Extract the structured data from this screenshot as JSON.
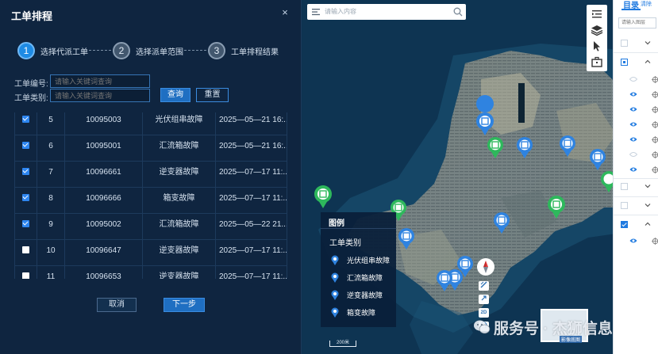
{
  "dialog": {
    "title": "工单排程",
    "close_symbol": "×",
    "steps": [
      {
        "num": "1",
        "label": "选择代派工单",
        "active": true
      },
      {
        "num": "2",
        "label": "选择派单范围",
        "active": false
      },
      {
        "num": "3",
        "label": "工单排程结果",
        "active": false
      }
    ],
    "filters": {
      "order_no_label": "工单编号:",
      "order_no_placeholder": "请输入关键词查询",
      "order_type_label": "工单类别:",
      "order_type_placeholder": "请输入关键词查询",
      "query_label": "查询",
      "reset_label": "重置"
    },
    "rows": [
      {
        "checked": true,
        "idx": "5",
        "no": "10095003",
        "type": "光伏组串故障",
        "time": "2025—05—21 16:..."
      },
      {
        "checked": true,
        "idx": "6",
        "no": "10095001",
        "type": "汇流箱故障",
        "time": "2025—05—21 16:..."
      },
      {
        "checked": true,
        "idx": "7",
        "no": "10096661",
        "type": "逆变器故障",
        "time": "2025—07—17 11:..."
      },
      {
        "checked": true,
        "idx": "8",
        "no": "10096666",
        "type": "箱变故障",
        "time": "2025—07—17 11:..."
      },
      {
        "checked": true,
        "idx": "9",
        "no": "10095002",
        "type": "汇流箱故障",
        "time": "2025—05—22 21..."
      },
      {
        "checked": false,
        "idx": "10",
        "no": "10096647",
        "type": "逆变器故障",
        "time": "2025—07—17 11:..."
      },
      {
        "checked": false,
        "idx": "11",
        "no": "10096653",
        "type": "逆变器故障",
        "time": "2025—07—17 11:..."
      }
    ],
    "cancel_label": "取消",
    "next_label": "下一步"
  },
  "map": {
    "search_placeholder": "请输入内容",
    "tools": [
      "list-indent-icon",
      "layers-icon",
      "pointer-icon",
      "toolbox-icon"
    ],
    "legend": {
      "title": "图例",
      "subtitle": "工单类别",
      "items": [
        {
          "label": "光伏组串故障",
          "color": "#2f83e0"
        },
        {
          "label": "汇流箱故障",
          "color": "#2f83e0"
        },
        {
          "label": "逆变器故障",
          "color": "#2f83e0"
        },
        {
          "label": "箱变故障",
          "color": "#2f83e0"
        }
      ]
    },
    "mini_buttons": [
      "",
      "",
      "2D",
      ""
    ],
    "overview_label": "影像底图",
    "scale_label": "200米",
    "watermark": "服务号 · 杰狮信息"
  },
  "panel": {
    "tab": "目录",
    "clear": "清除",
    "search_placeholder": "请输入图层",
    "accent": "#1f7ae0"
  },
  "colors": {
    "dialog_bg": "#0f2540",
    "primary": "#1f6fc2",
    "marker_blue": "#2f83e0",
    "marker_green": "#2eb85c"
  }
}
